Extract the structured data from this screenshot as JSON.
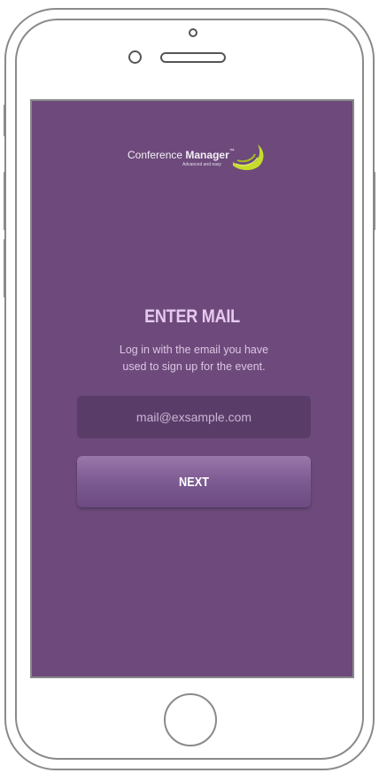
{
  "app": {
    "logo_text": "Conference",
    "logo_bold": "Manager",
    "logo_tm": "™",
    "logo_tagline": "Advanced and easy",
    "accent_color": "#c6dc2b"
  },
  "login": {
    "title": "ENTER MAIL",
    "subtitle_line1": "Log in with the email you have",
    "subtitle_line2": "used to sign up for the event.",
    "email_placeholder": "mail@exsample.com",
    "next_label": "NEXT"
  },
  "colors": {
    "background": "#6d4a7b",
    "input_bg": "#5a3c69",
    "title": "#e7c9f0"
  }
}
